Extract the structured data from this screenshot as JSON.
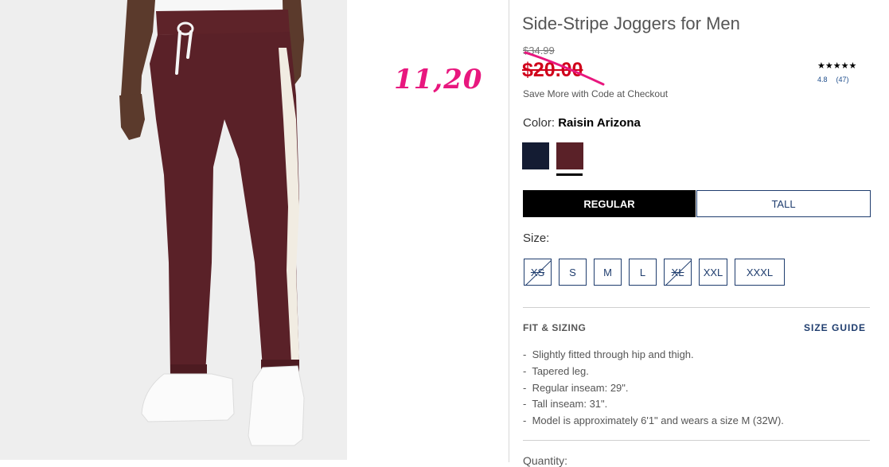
{
  "annotation": "11,20",
  "product": {
    "title": "Side-Stripe Joggers for Men",
    "original_price": "$34.99",
    "sale_price": "$20.00",
    "promo_text": "Save More with Code at Checkout",
    "rating": {
      "stars": "★★★★★",
      "score": "4.8",
      "count": "(47)"
    },
    "color": {
      "label": "Color: ",
      "selected": "Raisin Arizona",
      "swatches": [
        {
          "name": "Navy",
          "hex": "#141c33"
        },
        {
          "name": "Raisin Arizona",
          "hex": "#5a2128",
          "selected": true
        }
      ]
    },
    "fit_options": [
      {
        "label": "REGULAR",
        "selected": true
      },
      {
        "label": "TALL",
        "selected": false
      }
    ],
    "size_label": "Size:",
    "sizes": [
      {
        "label": "XS",
        "available": false
      },
      {
        "label": "S",
        "available": true
      },
      {
        "label": "M",
        "available": true
      },
      {
        "label": "L",
        "available": true
      },
      {
        "label": "XL",
        "available": false
      },
      {
        "label": "XXL",
        "available": true
      },
      {
        "label": "XXXL",
        "available": true
      }
    ],
    "fit_sizing": {
      "heading": "FIT & SIZING",
      "size_guide": "SIZE GUIDE",
      "details": [
        "Slightly fitted through hip and thigh.",
        "Tapered leg.",
        "Regular inseam: 29\".",
        "Tall inseam: 31\".",
        "Model is approximately 6'1\" and wears a size M (32W)."
      ]
    },
    "quantity_label": "Quantity:"
  },
  "colors": {
    "sale_red": "#d0011b",
    "annotation_pink": "#e8177e",
    "brand_navy": "#1f3d6e",
    "pants_raisin": "#5a2128"
  }
}
